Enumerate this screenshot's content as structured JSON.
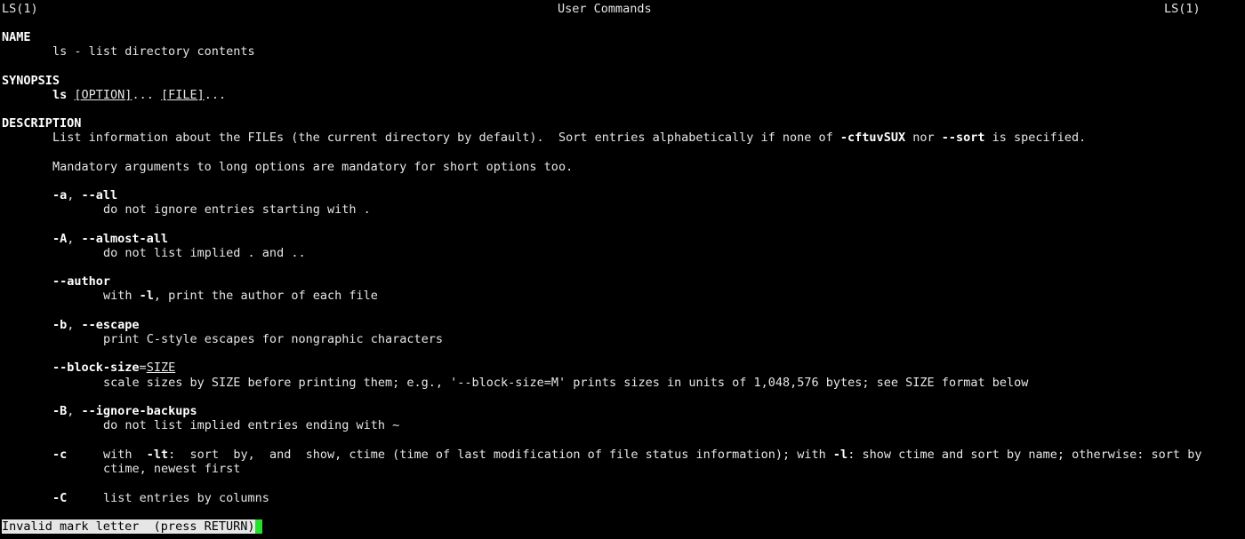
{
  "header": {
    "left": "LS(1)",
    "center": "User Commands",
    "right": "LS(1)"
  },
  "name_section": {
    "heading": "NAME",
    "text": "ls - list directory contents"
  },
  "synopsis": {
    "heading": "SYNOPSIS",
    "cmd": "ls",
    "opt1": "[OPTION]",
    "mid": "... ",
    "opt2": "[FILE]",
    "tail": "..."
  },
  "description": {
    "heading": "DESCRIPTION",
    "line1_a": "List information about the FILEs (the current directory by default).  Sort entries alphabetically if none of ",
    "line1_b": "-cftuvSUX",
    "line1_c": " nor ",
    "line1_d": "--sort",
    "line1_e": " is specified.",
    "line2": "Mandatory arguments to long options are mandatory for short options too."
  },
  "options": [
    {
      "flag_a": "-a",
      "sep": ", ",
      "flag_b": "--all",
      "desc": "do not ignore entries starting with ."
    },
    {
      "flag_a": "-A",
      "sep": ", ",
      "flag_b": "--almost-all",
      "desc": "do not list implied . and .."
    },
    {
      "flag_a": "--author",
      "desc_a": "with ",
      "desc_b": "-l",
      "desc_c": ", print the author of each file"
    },
    {
      "flag_a": "-b",
      "sep": ", ",
      "flag_b": "--escape",
      "desc": "print C-style escapes for nongraphic characters"
    },
    {
      "flag_a": "--block-size",
      "eq": "=",
      "arg": "SIZE",
      "desc": "scale sizes by SIZE before printing them; e.g., '--block-size=M' prints sizes in units of 1,048,576 bytes; see SIZE format below"
    },
    {
      "flag_a": "-B",
      "sep": ", ",
      "flag_b": "--ignore-backups",
      "desc": "do not list implied entries ending with ~"
    },
    {
      "flag_a": "-c",
      "desc_a": "with  ",
      "desc_b": "-lt",
      "desc_c": ":  sort  by,  and  show, ctime (time of last modification of file status information); with ",
      "desc_d": "-l",
      "desc_e": ": show ctime and sort by name; otherwise: sort by",
      "desc2": "ctime, newest first"
    },
    {
      "flag_a": "-C",
      "desc": "list entries by columns"
    }
  ],
  "status": {
    "message": "Invalid mark letter  (press RETURN)"
  }
}
